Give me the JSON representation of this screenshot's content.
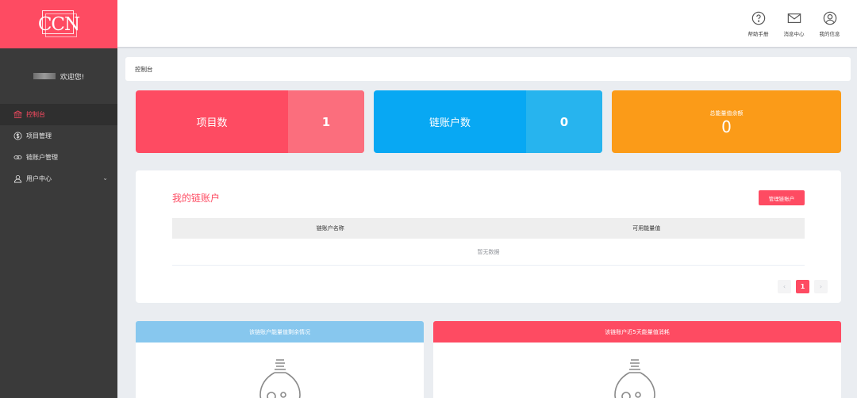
{
  "logo": {
    "text": "CCN"
  },
  "user": {
    "welcome": "欢迎您!"
  },
  "sidebar": {
    "items": [
      {
        "label": "控制台",
        "icon": "bank-icon",
        "active": true
      },
      {
        "label": "项目管理",
        "icon": "coin-icon",
        "active": false
      },
      {
        "label": "链账户管理",
        "icon": "link-icon",
        "active": false
      },
      {
        "label": "用户中心",
        "icon": "user-icon",
        "active": false,
        "has_submenu": true
      }
    ]
  },
  "topbar": {
    "help": "帮助手册",
    "messages": "消息中心",
    "profile": "我的信息"
  },
  "breadcrumb": "控制台",
  "stats": {
    "projects": {
      "label": "项目数",
      "value": "1"
    },
    "chain_accounts": {
      "label": "链账户数",
      "value": "0"
    },
    "energy": {
      "label": "总能量值余额",
      "value": "0"
    }
  },
  "colors": {
    "brand": "#fe4b62",
    "blue": "#08a8f3",
    "orange": "#fb9b18",
    "sidebar": "#3a3a3a"
  },
  "my_accounts": {
    "title": "我的链账户",
    "manage_button": "管理链账户",
    "columns": [
      "链账户名称",
      "可用能量值"
    ],
    "empty_text": "暂无数据",
    "pagination": {
      "prev": "‹",
      "current": "1",
      "next": "›"
    }
  },
  "charts": {
    "remaining": {
      "title": "该链账户能量值剩余情况"
    },
    "consumption": {
      "title": "该链账户近5天能量值消耗"
    }
  }
}
